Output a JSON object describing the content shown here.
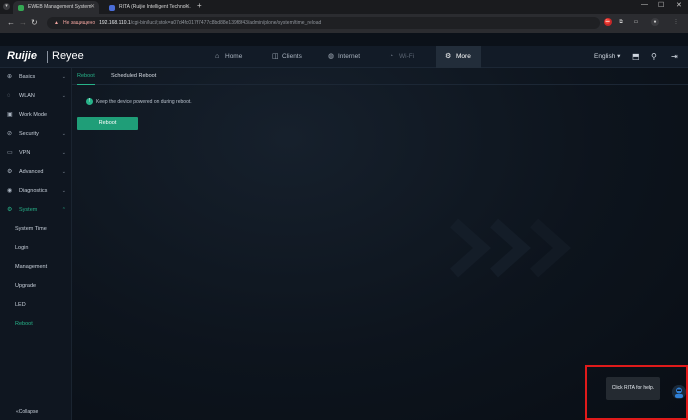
{
  "browser": {
    "tabs": [
      {
        "title": "EWEB Management System",
        "active": true,
        "favicon_color": "#34a853"
      },
      {
        "title": "RITA (Ruijie Intelligent Technol...",
        "active": false,
        "favicon_color": "#4a6dd8"
      }
    ],
    "address": {
      "security_warning": "Не защищено",
      "host": "192.168.110.1",
      "path": "/cgi-bin/luci/;stok=a07d4fc017f7477c8bd88e139f8f43/admin/plone/system/time_reload"
    }
  },
  "app": {
    "logo_primary": "Ruijie",
    "logo_secondary": "Reyee",
    "top_menu": [
      {
        "label": "Home",
        "icon": "home-icon"
      },
      {
        "label": "Clients",
        "icon": "clients-icon"
      },
      {
        "label": "Internet",
        "icon": "globe-icon"
      },
      {
        "label": "Wi-Fi",
        "icon": "wifi-icon"
      },
      {
        "label": "More",
        "icon": "gear-icon",
        "active": true
      }
    ],
    "language": "English"
  },
  "sidebar": {
    "items": [
      {
        "label": "Basics",
        "icon": "basics-icon",
        "expandable": true
      },
      {
        "label": "WLAN",
        "icon": "wlan-icon",
        "expandable": true
      },
      {
        "label": "Work Mode",
        "icon": "work-mode-icon",
        "expandable": false
      },
      {
        "label": "Security",
        "icon": "security-icon",
        "expandable": true
      },
      {
        "label": "VPN",
        "icon": "vpn-icon",
        "expandable": true
      },
      {
        "label": "Advanced",
        "icon": "advanced-icon",
        "expandable": true
      },
      {
        "label": "Diagnostics",
        "icon": "diagnostics-icon",
        "expandable": true
      },
      {
        "label": "System",
        "icon": "system-icon",
        "expandable": true,
        "open": true
      }
    ],
    "sub_items": [
      {
        "label": "System Time"
      },
      {
        "label": "Login"
      },
      {
        "label": "Management"
      },
      {
        "label": "Upgrade"
      },
      {
        "label": "LED"
      },
      {
        "label": "Reboot",
        "active": true
      }
    ],
    "collapse_label": "Collapse"
  },
  "main": {
    "tabs": [
      {
        "label": "Reboot",
        "active": true
      },
      {
        "label": "Scheduled Reboot",
        "active": false
      }
    ],
    "hint": "Keep the device powered on during reboot.",
    "reboot_button": "Reboot"
  },
  "help": {
    "tooltip": "Click RITA for help."
  },
  "colors": {
    "accent": "#27b389",
    "button": "#1f9e78",
    "highlight_border": "#e01a1a"
  }
}
